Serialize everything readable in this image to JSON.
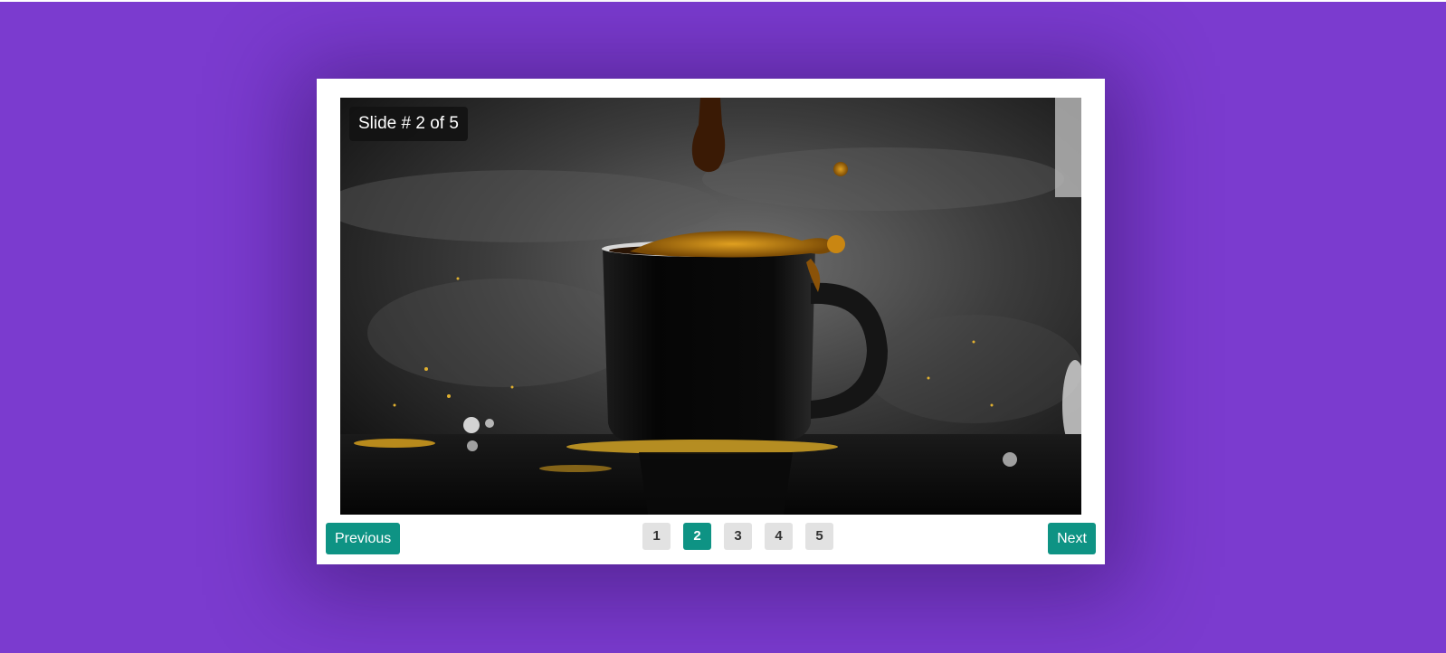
{
  "slider": {
    "counter": "Slide # 2 of 5",
    "image_description": "coffee-cup-splash",
    "prev_label": "Previous",
    "next_label": "Next",
    "current_page": 2,
    "pages": [
      "1",
      "2",
      "3",
      "4",
      "5"
    ]
  },
  "colors": {
    "background": "#7b3bcf",
    "accent": "#0e9384",
    "page_inactive": "#e2e2e2"
  }
}
